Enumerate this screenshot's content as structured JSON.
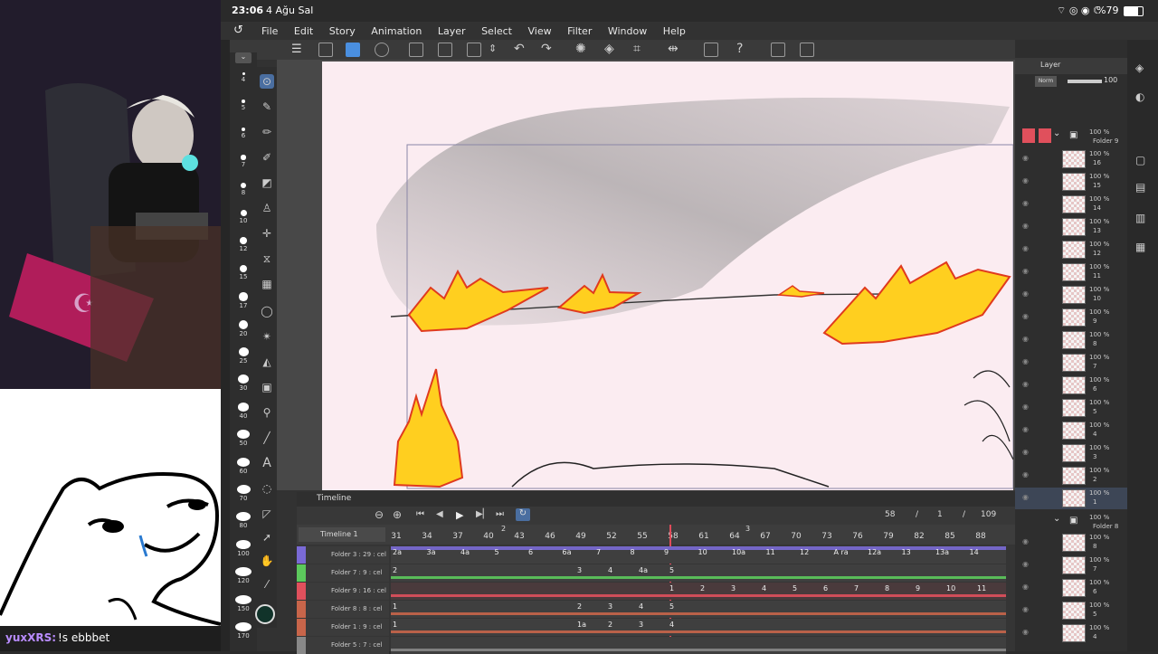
{
  "status": {
    "time": "23:06",
    "date": "4 Ağu Sal",
    "battery": "%79"
  },
  "menu": [
    "File",
    "Edit",
    "Story",
    "Animation",
    "Layer",
    "Select",
    "View",
    "Filter",
    "Window",
    "Help"
  ],
  "brush_sizes": [
    "4",
    "5",
    "6",
    "7",
    "8",
    "10",
    "12",
    "15",
    "17",
    "20",
    "25",
    "30",
    "40",
    "50",
    "60",
    "70",
    "80",
    "100",
    "120",
    "150",
    "170"
  ],
  "chat": {
    "user": "yuxXRS:",
    "message": "!s ebbbet"
  },
  "timeline": {
    "panel_title": "Timeline",
    "name": "Timeline 1",
    "current_frame": "58",
    "slash": "/",
    "page": "1",
    "slash2": "/",
    "total": "109",
    "ruler": [
      "31",
      "34",
      "37",
      "40",
      "43",
      "46",
      "49",
      "52",
      "55",
      "58",
      "61",
      "64",
      "67",
      "70",
      "73",
      "76",
      "79",
      "82",
      "85",
      "88"
    ],
    "ruler_marks": [
      {
        "label": "2"
      },
      {
        "label": "3"
      }
    ],
    "tracks": [
      {
        "name": "Folder 3 : 29 : cel",
        "color": "#7a6ad6",
        "cels": [
          "2a",
          "3a",
          "4a",
          "5",
          "6",
          "6a",
          "7",
          "8",
          "9",
          "10",
          "10a",
          "11",
          "12",
          "A ra",
          "12a",
          "13",
          "13a",
          "14"
        ]
      },
      {
        "name": "Folder 7 : 9 : cel",
        "color": "#5cc95c",
        "cels": [
          "2",
          "3",
          "4",
          "4a",
          "5"
        ]
      },
      {
        "name": "Folder 9 : 16 : cel",
        "color": "#e0505c",
        "cels": [
          "1",
          "2",
          "3",
          "4",
          "5",
          "6",
          "7",
          "8",
          "9",
          "10",
          "11"
        ]
      },
      {
        "name": "Folder 8 : 8 : cel",
        "color": "#c8654a",
        "cels": [
          "1",
          "2",
          "3",
          "4",
          "5"
        ]
      },
      {
        "name": "Folder 1 : 9 : cel",
        "color": "#c8654a",
        "cels": [
          "1",
          "1a",
          "2",
          "3",
          "4"
        ]
      },
      {
        "name": "Folder 5 : 7 : cel",
        "color": "#888888",
        "cels": []
      }
    ]
  },
  "layers": {
    "tab": "Layer",
    "blend": "Norm",
    "opacity": "100",
    "folder9": {
      "pct": "100 %",
      "name": "Folder 9"
    },
    "items": [
      {
        "pct": "100 %",
        "name": "16"
      },
      {
        "pct": "100 %",
        "name": "15"
      },
      {
        "pct": "100 %",
        "name": "14"
      },
      {
        "pct": "100 %",
        "name": "13"
      },
      {
        "pct": "100 %",
        "name": "12"
      },
      {
        "pct": "100 %",
        "name": "11"
      },
      {
        "pct": "100 %",
        "name": "10"
      },
      {
        "pct": "100 %",
        "name": "9"
      },
      {
        "pct": "100 %",
        "name": "8"
      },
      {
        "pct": "100 %",
        "name": "7"
      },
      {
        "pct": "100 %",
        "name": "6"
      },
      {
        "pct": "100 %",
        "name": "5"
      },
      {
        "pct": "100 %",
        "name": "4"
      },
      {
        "pct": "100 %",
        "name": "3"
      },
      {
        "pct": "100 %",
        "name": "2"
      },
      {
        "pct": "100 %",
        "name": "1"
      }
    ],
    "folder8": {
      "pct": "100 %",
      "name": "Folder 8"
    },
    "items8": [
      {
        "pct": "100 %",
        "name": "8"
      },
      {
        "pct": "100 %",
        "name": "7"
      },
      {
        "pct": "100 %",
        "name": "6"
      },
      {
        "pct": "100 %",
        "name": "5"
      },
      {
        "pct": "100 %",
        "name": "4"
      }
    ]
  },
  "colors": {
    "accent": "#4a8fe0",
    "canvas": "#fbecf1",
    "fire_yellow": "#ffd21a",
    "fire_red": "#e03a1e",
    "selected_track": "#e0505c"
  }
}
